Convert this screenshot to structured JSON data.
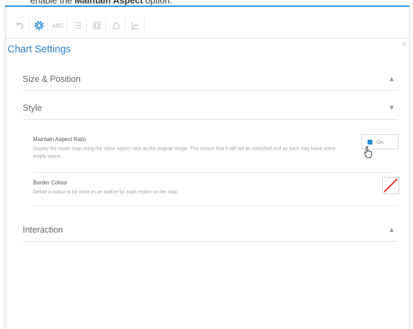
{
  "caption": {
    "prefix": "enable the ",
    "bold": "Maintain Aspect",
    "suffix": " option."
  },
  "toolbar": {
    "items": [
      "undo-icon",
      "gear-icon",
      "abc-text-icon",
      "list-icon",
      "image-frame-icon",
      "eraser-icon",
      "chart-icon"
    ],
    "abc_label": "ABC"
  },
  "panel": {
    "title": "Chart Settings",
    "close_glyph": "×",
    "accent_color": "#2a7cc7"
  },
  "sections": {
    "size_position": {
      "label": "Size & Position",
      "chevron": "▲"
    },
    "style": {
      "label": "Style",
      "chevron": "▼"
    },
    "interaction": {
      "label": "Interaction",
      "chevron": "▲"
    }
  },
  "style_options": {
    "aspect": {
      "title": "Maintain Aspect Ratio",
      "description": "Display the raster map using the same aspect ratio as the original image. This means that it will not be stretched and as such may leave some empty space.",
      "toggle_label": "On",
      "toggle_color": "#2a8fd6"
    },
    "border": {
      "title": "Border Colour",
      "description": "Define a colour to be used as an outline for each region on the map.",
      "swatch": "none"
    }
  }
}
